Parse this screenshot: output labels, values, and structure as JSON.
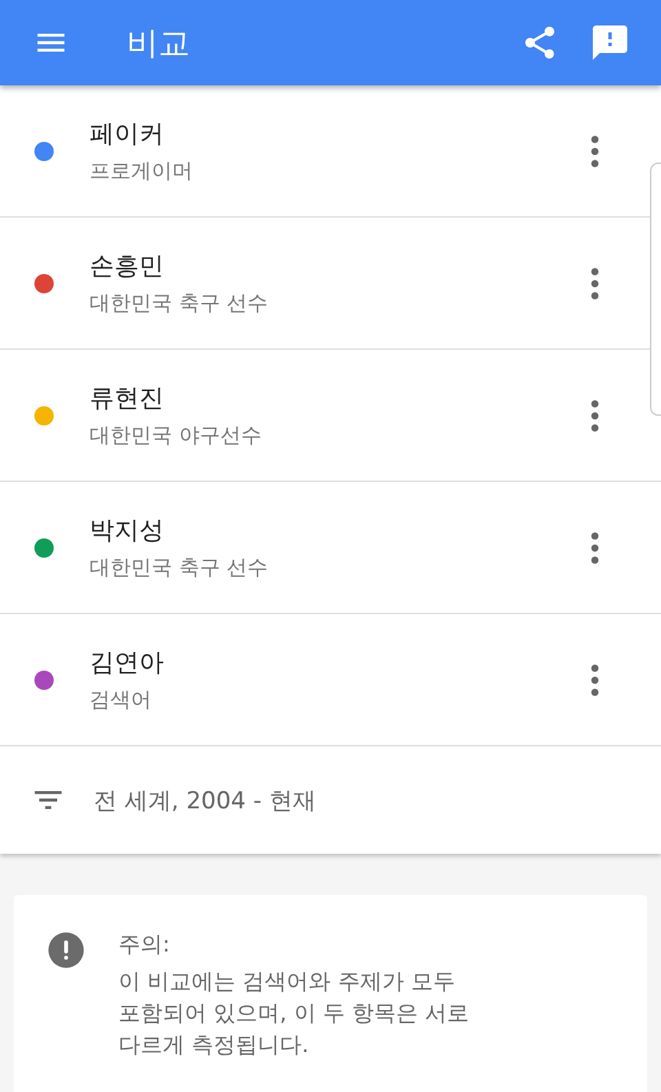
{
  "app_bar": {
    "title": "비교"
  },
  "terms": [
    {
      "name": "페이커",
      "subtitle": "프로게이머",
      "color": "#4285f4"
    },
    {
      "name": "손흥민",
      "subtitle": "대한민국 축구 선수",
      "color": "#db4437"
    },
    {
      "name": "류현진",
      "subtitle": "대한민국 야구선수",
      "color": "#f4b400"
    },
    {
      "name": "박지성",
      "subtitle": "대한민국 축구 선수",
      "color": "#0f9d58"
    },
    {
      "name": "김연아",
      "subtitle": "검색어",
      "color": "#ab47bc"
    }
  ],
  "filter": {
    "label": "전 세계, 2004 - 현재"
  },
  "notice": {
    "title": "주의:",
    "lines": [
      "이 비교에는 검색어와 주제가 모두",
      "포함되어 있으며, 이 두 항목은 서로",
      "다르게 측정됩니다."
    ]
  }
}
